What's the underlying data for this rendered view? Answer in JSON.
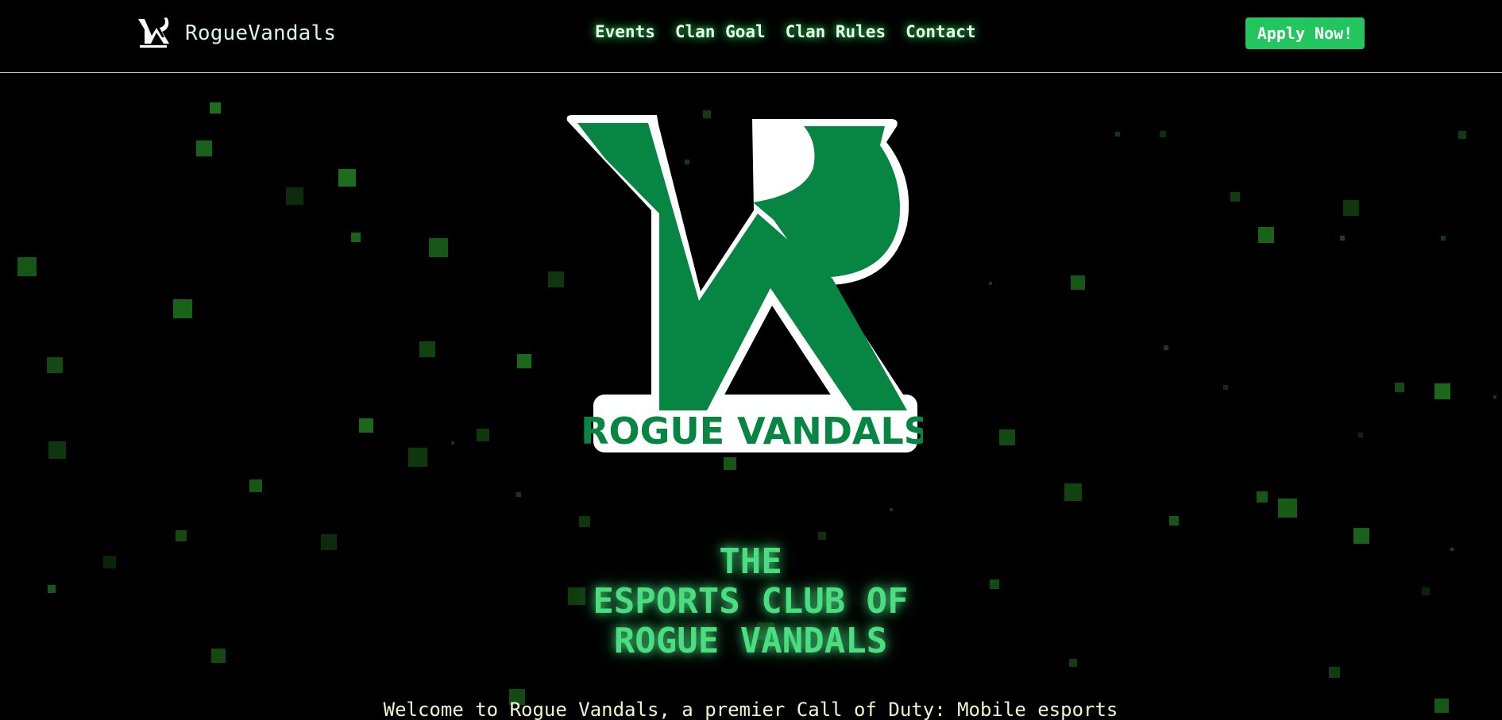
{
  "header": {
    "brand_name": "RogueVandals",
    "brand_logo_icon": "rogue-vandals-rv-logo-icon",
    "nav": [
      {
        "label": "Events"
      },
      {
        "label": "Clan Goal"
      },
      {
        "label": "Clan Rules"
      },
      {
        "label": "Contact"
      }
    ],
    "cta_label": "Apply Now!"
  },
  "hero": {
    "logo_text": "ROGUE VANDALS",
    "headline": [
      "THE",
      "ESPORTS CLUB OF",
      "ROGUE VANDALS"
    ],
    "intro": "Welcome to Rogue Vandals, a premier Call of Duty: Mobile esports"
  },
  "colors": {
    "background": "#000000",
    "accent_green": "#22c55e",
    "headline_green": "#4ade80",
    "logo_green": "#078543",
    "particle_green": "#1f7a1f"
  }
}
